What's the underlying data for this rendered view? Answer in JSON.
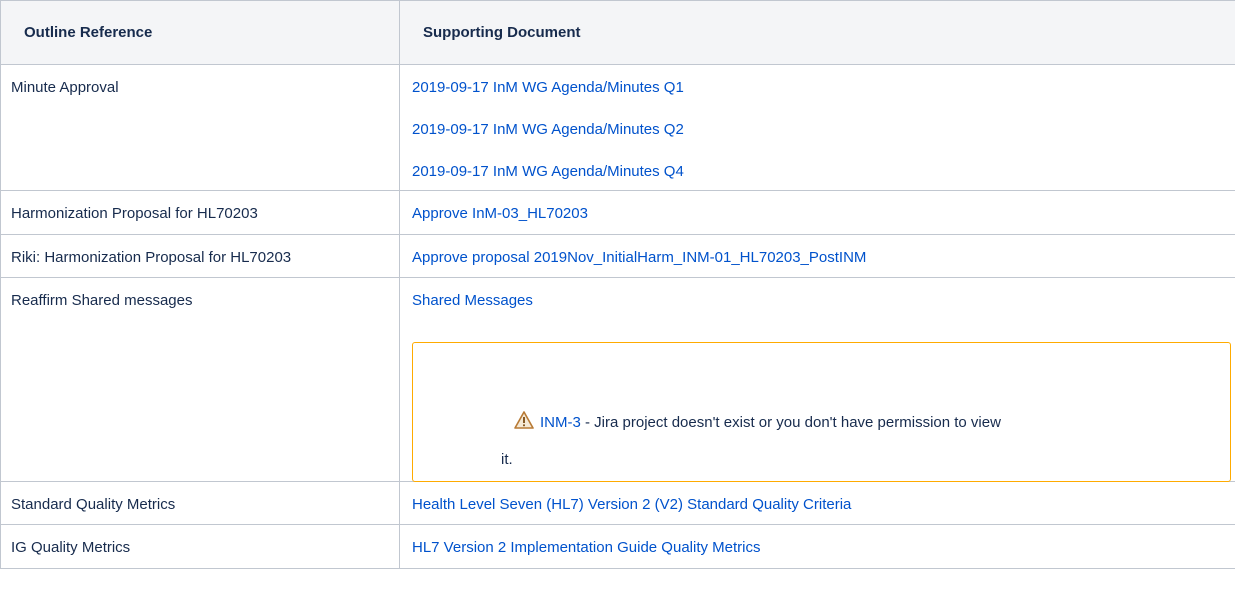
{
  "table": {
    "headers": [
      "Outline Reference",
      "Supporting Document"
    ],
    "rows": [
      {
        "reference": "Minute Approval",
        "links": [
          "2019-09-17 InM WG Agenda/Minutes Q1",
          "2019-09-17 InM WG Agenda/Minutes Q2",
          "2019-09-17 InM WG Agenda/Minutes Q4"
        ]
      },
      {
        "reference": "Harmonization Proposal for HL70203",
        "links": [
          "Approve InM-03_HL70203"
        ]
      },
      {
        "reference": "Riki: Harmonization Proposal for HL70203",
        "links": [
          "Approve proposal 2019Nov_InitialHarm_INM-01_HL70203_PostINM"
        ]
      },
      {
        "reference": "Reaffirm Shared messages",
        "links": [
          "Shared Messages"
        ]
      },
      {
        "reference": "Standard Quality Metrics",
        "links": [
          "Health Level Seven (HL7) Version 2 (V2) Standard Quality Criteria"
        ]
      },
      {
        "reference": "IG Quality Metrics",
        "links": [
          "HL7 Version 2 Implementation Guide Quality Metrics"
        ]
      }
    ]
  },
  "jira_warning": {
    "icon": "warning-triangle-icon",
    "issue_key": "INM-3",
    "message_line1": " - Jira project doesn't exist or you don't have permission to view",
    "message_line2": "it."
  },
  "colors": {
    "link": "#0052cc",
    "border": "#c1c7d0",
    "header_bg": "#f4f5f7",
    "warning_border": "#ffab00",
    "warning_icon": "#c47e2a"
  }
}
